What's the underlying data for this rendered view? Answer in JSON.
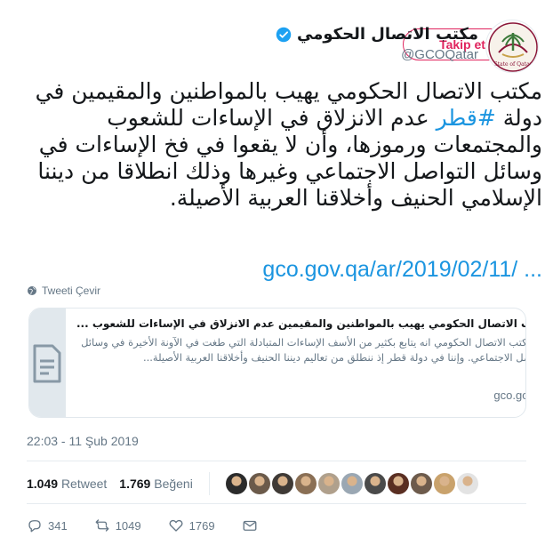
{
  "user": {
    "display_name": "مكتب الاتصال الحكومي",
    "handle": "@GCOQatar",
    "verified": true,
    "follow_label": "Takip et",
    "avatar_text": "State of Qatar"
  },
  "tweet": {
    "text_before": "مكتب الاتصال الحكومي يهيب بالمواطنين والمقيمين في دولة ",
    "hashtag": "#قطر",
    "text_after": " عدم الانزلاق في الإساءات للشعوب والمجتمعات ورموزها، وأن لا يقعوا في فخ الإساءات في وسائل التواصل الاجتماعي وغيرها وذلك انطلاقا من ديننا الإسلامي الحنيف وأخلاقنا العربية الأصيلة.",
    "link": "gco.gov.qa/ar/2019/02/11/ ...",
    "translate_label": "Tweeti Çevir"
  },
  "card": {
    "title": "مكتب الاتصال الحكومي يهيب بالمواطنين والمقيمين عدم الانزلاق في الإساءات للشعوب ...",
    "description": "اكد مكتب الاتصال الحكومي انه يتابع بكثير من الأسف الإساءات المتبادلة التي طغت في الآونة الأخيرة في وسائل التواصل الاجتماعي. وإننا في دولة قطر إذ ننطلق من تعاليم ديننا الحنيف وأخلاقنا العربية الأصيلة...",
    "domain": "gco.gov.qa"
  },
  "meta": {
    "timestamp": "22:03 - 11 Şub 2019"
  },
  "stats": {
    "retweets_count": "1.049",
    "retweets_label": "Retweet",
    "likes_count": "1.769",
    "likes_label": "Beğeni"
  },
  "actions": {
    "replies": "341",
    "retweets": "1049",
    "likes": "1769"
  },
  "colors": {
    "accent": "#1b95e0",
    "follow": "#e0245e",
    "muted": "#657786"
  },
  "likers": [
    "#2b2b2b",
    "#6b5a4a",
    "#3f3a36",
    "#8a6f55",
    "#b0a08c",
    "#9aa7b3",
    "#4a4a4a",
    "#5a2f22",
    "#6d5b4c",
    "#c9a26c",
    "#e3e3e3"
  ]
}
